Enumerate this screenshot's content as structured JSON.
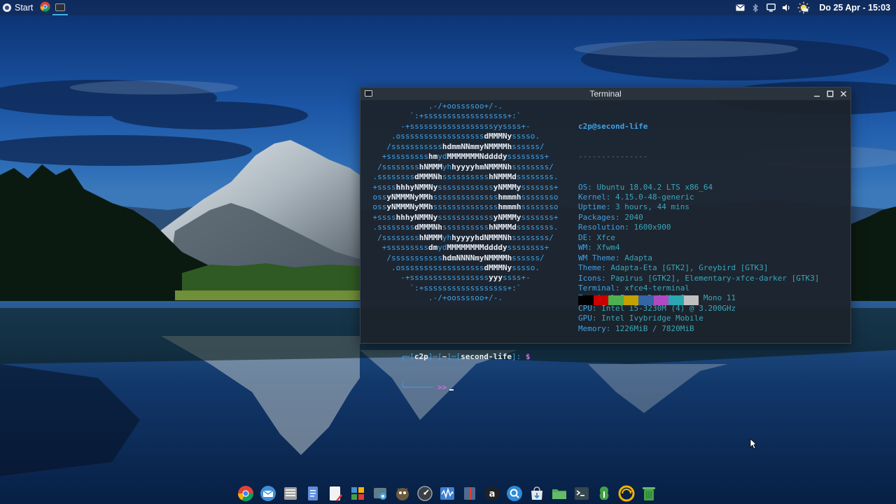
{
  "top_panel": {
    "start_label": "Start",
    "clock": "Do 25 Apr - 15:03",
    "launchers": [
      "chrome-icon",
      "terminal-icon"
    ],
    "tray": [
      "mail-icon",
      "bluetooth-icon",
      "display-icon",
      "volume-icon",
      "weather-sun-icon"
    ]
  },
  "terminal": {
    "title": "Terminal",
    "logo_lines": [
      [
        {
          "t": ".-/+oossssoo+/-."
        }
      ],
      [
        {
          "t": "`:+ssssssssssssssssss+:`"
        }
      ],
      [
        {
          "t": "-+ssssssssssssssssssyyssss+-"
        }
      ],
      [
        {
          "t": ".ossssssssssssssssss"
        },
        {
          "t": "dMMMNy",
          "b": true
        },
        {
          "t": "sssso."
        }
      ],
      [
        {
          "t": "/sssssssssss"
        },
        {
          "t": "hdmmNNmmyNMMMMh",
          "b": true
        },
        {
          "t": "ssssss/"
        }
      ],
      [
        {
          "t": "+sssssssss"
        },
        {
          "t": "hm",
          "b": true
        },
        {
          "t": "yd"
        },
        {
          "t": "MMMMMMMNddddy",
          "b": true
        },
        {
          "t": "ssssssss+"
        }
      ],
      [
        {
          "t": "/ssssssss"
        },
        {
          "t": "hNMMM",
          "b": true
        },
        {
          "t": "yh"
        },
        {
          "t": "hyyyyhmNMMMNh",
          "b": true
        },
        {
          "t": "ssssssss/"
        }
      ],
      [
        {
          "t": ".ssssssss"
        },
        {
          "t": "dMMMNh",
          "b": true
        },
        {
          "t": "ssssssssss"
        },
        {
          "t": "hNMMMd",
          "b": true
        },
        {
          "t": "ssssssss."
        }
      ],
      [
        {
          "t": "+ssss"
        },
        {
          "t": "hhhyNMMNy",
          "b": true
        },
        {
          "t": "ssssssssssss"
        },
        {
          "t": "yNMMMy",
          "b": true
        },
        {
          "t": "sssssss+"
        }
      ],
      [
        {
          "t": "oss"
        },
        {
          "t": "yNMMMNyMMh",
          "b": true
        },
        {
          "t": "ssssssssssssss"
        },
        {
          "t": "hmmmh",
          "b": true
        },
        {
          "t": "ssssssso"
        }
      ],
      [
        {
          "t": "oss"
        },
        {
          "t": "yNMMMNyMMh",
          "b": true
        },
        {
          "t": "ssssssssssssss"
        },
        {
          "t": "hmmmh",
          "b": true
        },
        {
          "t": "ssssssso"
        }
      ],
      [
        {
          "t": "+ssss"
        },
        {
          "t": "hhhyNMMNy",
          "b": true
        },
        {
          "t": "ssssssssssss"
        },
        {
          "t": "yNMMMy",
          "b": true
        },
        {
          "t": "sssssss+"
        }
      ],
      [
        {
          "t": ".ssssssss"
        },
        {
          "t": "dMMMNh",
          "b": true
        },
        {
          "t": "ssssssssss"
        },
        {
          "t": "hNMMMd",
          "b": true
        },
        {
          "t": "ssssssss."
        }
      ],
      [
        {
          "t": "/ssssssss"
        },
        {
          "t": "hNMMM",
          "b": true
        },
        {
          "t": "yh"
        },
        {
          "t": "hyyyyhdNMMMNh",
          "b": true
        },
        {
          "t": "ssssssss/"
        }
      ],
      [
        {
          "t": "+sssssssss"
        },
        {
          "t": "dm",
          "b": true
        },
        {
          "t": "yd"
        },
        {
          "t": "MMMMMMMMddddy",
          "b": true
        },
        {
          "t": "ssssssss+"
        }
      ],
      [
        {
          "t": "/sssssssssss"
        },
        {
          "t": "hdmNNNNmyNMMMMh",
          "b": true
        },
        {
          "t": "ssssss/"
        }
      ],
      [
        {
          "t": ".ossssssssssssssssss"
        },
        {
          "t": "dMMMNy",
          "b": true
        },
        {
          "t": "sssso."
        }
      ],
      [
        {
          "t": "-+sssssssssssssssss"
        },
        {
          "t": "yyy",
          "b": true
        },
        {
          "t": "ssss+-"
        }
      ],
      [
        {
          "t": "`:+ssssssssssssssssss+:`"
        }
      ],
      [
        {
          "t": ".-/+oossssoo+/-."
        }
      ]
    ],
    "user_host": "c2p@second-life",
    "separator": "---------------",
    "info": [
      {
        "key": "OS",
        "value": "Ubuntu 18.04.2 LTS x86_64"
      },
      {
        "key": "Kernel",
        "value": "4.15.0-48-generic"
      },
      {
        "key": "Uptime",
        "value": "3 hours, 44 mins"
      },
      {
        "key": "Packages",
        "value": "2040"
      },
      {
        "key": "Resolution",
        "value": "1600x900"
      },
      {
        "key": "DE",
        "value": "Xfce"
      },
      {
        "key": "WM",
        "value": "Xfwm4"
      },
      {
        "key": "WM Theme",
        "value": "Adapta"
      },
      {
        "key": "Theme",
        "value": "Adapta-Eta [GTK2], Greybird [GTK3]"
      },
      {
        "key": "Icons",
        "value": "Papirus [GTK2], Elementary-xfce-darker [GTK3]"
      },
      {
        "key": "Terminal",
        "value": "xfce4-terminal"
      },
      {
        "key": "Terminal Font",
        "value": "DejaVu Sans Mono 11"
      },
      {
        "key": "CPU",
        "value": "Intel i5-3230M (4) @ 3.200GHz"
      },
      {
        "key": "GPU",
        "value": "Intel Ivybridge Mobile"
      },
      {
        "key": "Memory",
        "value": "1226MiB / 7820MiB"
      }
    ],
    "palette": [
      "#000000",
      "#cc0000",
      "#4caf50",
      "#c4a000",
      "#3465a4",
      "#b04ac0",
      "#2aa7b0",
      "#bfbfbf"
    ],
    "prompt": {
      "line1_prefix": "┌─[",
      "user": "c2p",
      "sep1": "]─[",
      "dir": "~",
      "sep2": "]─[",
      "host": "second-life",
      "suffix": "]:",
      "dollar": "$",
      "line2_prefix": "└──────",
      "arrow": ">>"
    }
  },
  "dock": {
    "items": [
      {
        "name": "chrome-icon",
        "color": "#e53935"
      },
      {
        "name": "thunderbird-icon",
        "color": "#3f8ed8"
      },
      {
        "name": "file-manager-icon",
        "color": "#9e9e9e"
      },
      {
        "name": "document-icon",
        "color": "#5b8de0"
      },
      {
        "name": "text-editor-icon",
        "color": "#f2f2f2"
      },
      {
        "name": "app-grid-icon",
        "color": "#4a8fd6"
      },
      {
        "name": "screenshot-icon",
        "color": "#49a0d8"
      },
      {
        "name": "gimp-icon",
        "color": "#6b5a3e"
      },
      {
        "name": "system-monitor-icon",
        "color": "#9aa0a6"
      },
      {
        "name": "waveform-icon",
        "color": "#3c7fd1"
      },
      {
        "name": "dictionary-icon",
        "color": "#4f6b8f"
      },
      {
        "name": "archive-icon",
        "color": "#212121"
      },
      {
        "name": "search-icon",
        "color": "#2e8bd6"
      },
      {
        "name": "software-center-icon",
        "color": "#e7e7e7"
      },
      {
        "name": "folder-icon",
        "color": "#4caf50"
      },
      {
        "name": "terminal-icon",
        "color": "#37474f"
      },
      {
        "name": "gnome-extension-icon",
        "color": "#43a047"
      },
      {
        "name": "sync-icon",
        "color": "#f2b400"
      },
      {
        "name": "trash-icon",
        "color": "#43a047"
      }
    ]
  }
}
